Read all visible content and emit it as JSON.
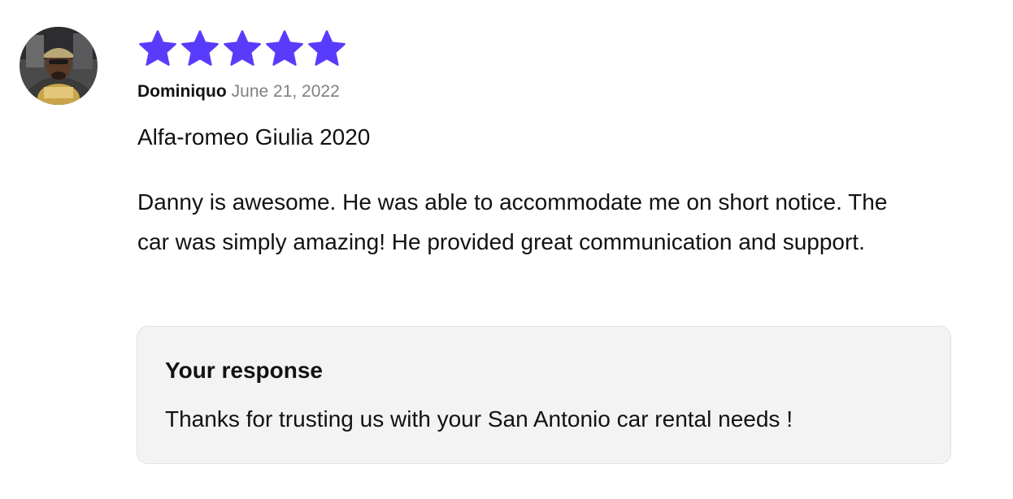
{
  "review": {
    "rating": 5,
    "rating_max": 5,
    "star_color": "#593CFB",
    "author": "Dominiquo",
    "date": "June 21, 2022",
    "vehicle": "Alfa-romeo Giulia 2020",
    "text": "Danny is awesome. He was able to accommodate me on short notice. The car was simply amazing! He provided great communication and support."
  },
  "response": {
    "title": "Your response",
    "text": "Thanks for trusting us with your San Antonio car rental needs !"
  }
}
